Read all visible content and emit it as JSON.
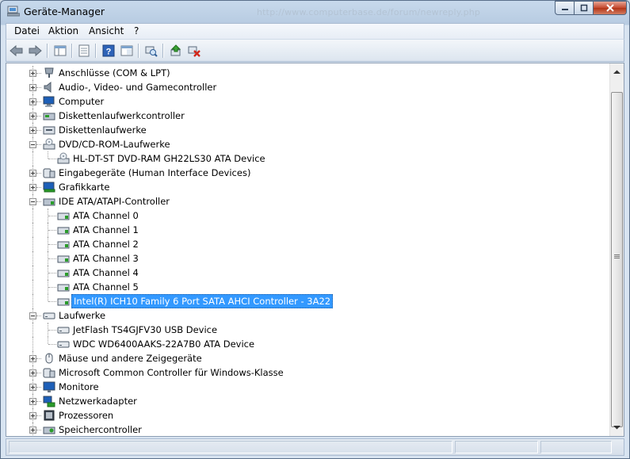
{
  "window": {
    "title": "Geräte-Manager",
    "ghost_url": "http://www.computerbase.de/forum/newreply.php",
    "minimize_glyph": "–",
    "maximize_glyph": "▢",
    "close_glyph": "✕"
  },
  "menu": [
    "Datei",
    "Aktion",
    "Ansicht",
    "?"
  ],
  "toolbar": {
    "buttons": [
      "back-arrow-icon",
      "forward-arrow-icon",
      "show-hide-console-tree-icon",
      "properties-icon",
      "help-icon",
      "extended-view-icon",
      "scan-hardware-icon",
      "update-driver-icon",
      "uninstall-icon"
    ]
  },
  "tree": [
    {
      "label": "Anschlüsse (COM & LPT)",
      "expander": "+",
      "icon": "port-icon",
      "level": 1
    },
    {
      "label": "Audio-, Video- und Gamecontroller",
      "expander": "+",
      "icon": "speaker-icon",
      "level": 1
    },
    {
      "label": "Computer",
      "expander": "+",
      "icon": "computer-icon",
      "level": 1
    },
    {
      "label": "Diskettenlaufwerkcontroller",
      "expander": "+",
      "icon": "floppy-controller-icon",
      "level": 1
    },
    {
      "label": "Diskettenlaufwerke",
      "expander": "+",
      "icon": "floppy-drive-icon",
      "level": 1
    },
    {
      "label": "DVD/CD-ROM-Laufwerke",
      "expander": "-",
      "icon": "dvd-drive-icon",
      "level": 1
    },
    {
      "label": "HL-DT-ST DVD-RAM GH22LS30 ATA Device",
      "icon": "dvd-drive-icon",
      "level": 2
    },
    {
      "label": "Eingabegeräte (Human Interface Devices)",
      "expander": "+",
      "icon": "hid-icon",
      "level": 1
    },
    {
      "label": "Grafikkarte",
      "expander": "+",
      "icon": "display-adapter-icon",
      "level": 1
    },
    {
      "label": "IDE ATA/ATAPI-Controller",
      "expander": "-",
      "icon": "ide-controller-icon",
      "level": 1
    },
    {
      "label": "ATA Channel 0",
      "icon": "ide-channel-icon",
      "level": 2
    },
    {
      "label": "ATA Channel 1",
      "icon": "ide-channel-icon",
      "level": 2
    },
    {
      "label": "ATA Channel 2",
      "icon": "ide-channel-icon",
      "level": 2
    },
    {
      "label": "ATA Channel 3",
      "icon": "ide-channel-icon",
      "level": 2
    },
    {
      "label": "ATA Channel 4",
      "icon": "ide-channel-icon",
      "level": 2
    },
    {
      "label": "ATA Channel 5",
      "icon": "ide-channel-icon",
      "level": 2
    },
    {
      "label": "Intel(R) ICH10 Family 6 Port SATA AHCI Controller - 3A22",
      "icon": "ide-channel-icon",
      "level": 2,
      "selected": true
    },
    {
      "label": "Laufwerke",
      "expander": "-",
      "icon": "disk-drive-icon",
      "level": 1
    },
    {
      "label": "JetFlash TS4GJFV30 USB Device",
      "icon": "disk-drive-icon",
      "level": 2
    },
    {
      "label": "WDC WD6400AAKS-22A7B0 ATA Device",
      "icon": "disk-drive-icon",
      "level": 2
    },
    {
      "label": "Mäuse und andere Zeigegeräte",
      "expander": "+",
      "icon": "mouse-icon",
      "level": 1
    },
    {
      "label": "Microsoft Common Controller für Windows-Klasse",
      "expander": "+",
      "icon": "hid-icon",
      "level": 1
    },
    {
      "label": "Monitore",
      "expander": "+",
      "icon": "monitor-icon",
      "level": 1
    },
    {
      "label": "Netzwerkadapter",
      "expander": "+",
      "icon": "network-adapter-icon",
      "level": 1
    },
    {
      "label": "Prozessoren",
      "expander": "+",
      "icon": "processor-icon",
      "level": 1
    },
    {
      "label": "Speichercontroller",
      "expander": "+",
      "icon": "storage-controller-icon",
      "level": 1
    }
  ],
  "colors": {
    "selection": "#3399ff",
    "title_gradient_top": "#c7d9ec",
    "close_button": "#c4482e"
  }
}
